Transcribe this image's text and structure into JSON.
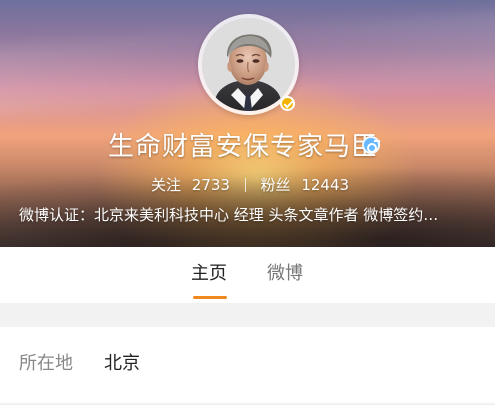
{
  "profile": {
    "name": "生命财富安保专家马臣",
    "stats": {
      "following_label": "关注",
      "following_value": "2733",
      "followers_label": "粉丝",
      "followers_value": "12443"
    },
    "verification_text": "微博认证：北京来美利科技中心 经理 头条文章作者 微博签约…"
  },
  "tabs": {
    "home": "主页",
    "weibo": "微博"
  },
  "details": {
    "location_label": "所在地",
    "location_value": "北京"
  },
  "colors": {
    "accent": "#f08a1f",
    "verified_badge": "#f2b400",
    "gender_badge": "#66b8ff"
  },
  "icons": {
    "verified": "verified-check-icon",
    "gender": "male-icon"
  }
}
